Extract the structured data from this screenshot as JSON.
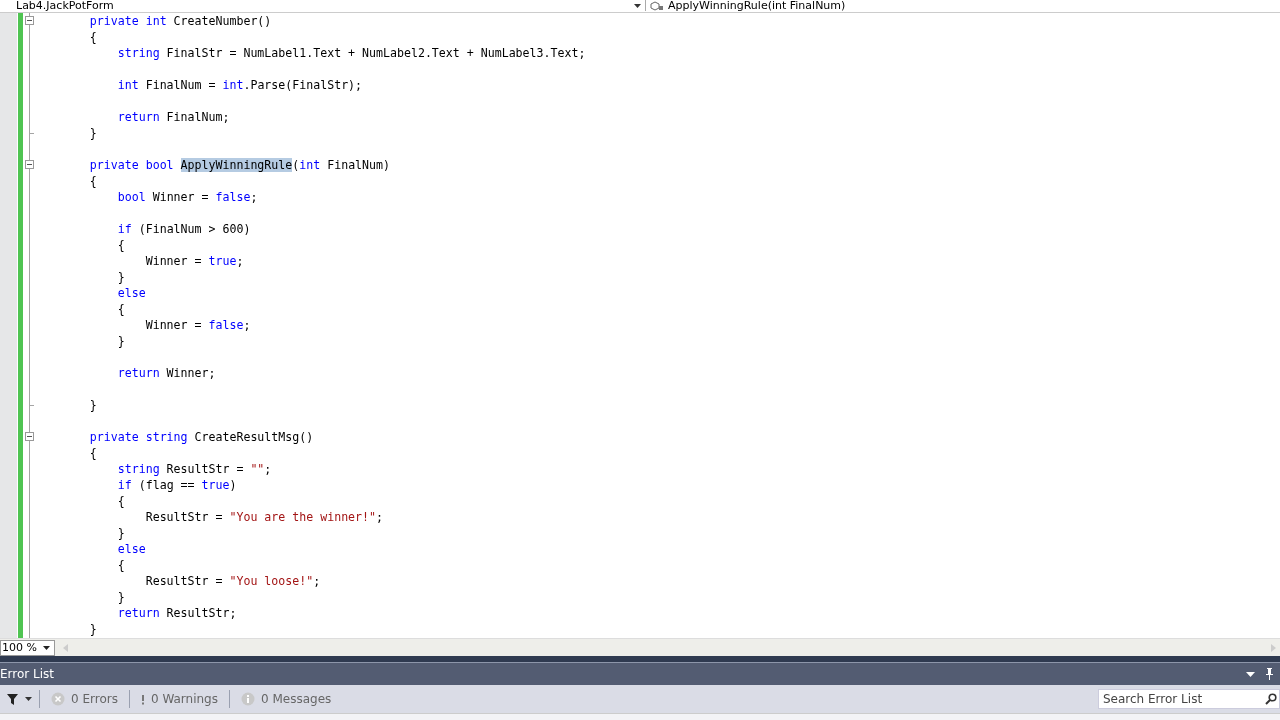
{
  "nav_bar": {
    "type_dropdown": "Lab4.JackPotForm",
    "member_dropdown": "ApplyWinningRule(int FinalNum)"
  },
  "code_lines": [
    {
      "kind": "header",
      "tokens": [
        {
          "kind": "kw",
          "t": "        private int"
        },
        {
          "kind": "plain",
          "t": " CreateNumber()"
        }
      ]
    },
    {
      "kind": "code",
      "tokens": [
        {
          "kind": "plain",
          "t": "        {"
        }
      ]
    },
    {
      "kind": "code",
      "tokens": [
        {
          "kind": "kw",
          "t": "            string"
        },
        {
          "kind": "plain",
          "t": " FinalStr = NumLabel1.Text + NumLabel2.Text + NumLabel3.Text;"
        }
      ]
    },
    {
      "kind": "code"
    },
    {
      "kind": "code",
      "tokens": [
        {
          "kind": "kw",
          "t": "            int"
        },
        {
          "kind": "plain",
          "t": " FinalNum = "
        },
        {
          "kind": "kw",
          "t": "int"
        },
        {
          "kind": "plain",
          "t": ".Parse(FinalStr);"
        }
      ]
    },
    {
      "kind": "code"
    },
    {
      "kind": "code",
      "tokens": [
        {
          "kind": "kw",
          "t": "            return"
        },
        {
          "kind": "plain",
          "t": " FinalNum;"
        }
      ]
    },
    {
      "kind": "end",
      "tokens": [
        {
          "kind": "plain",
          "t": "        }"
        }
      ]
    },
    {
      "kind": "code"
    },
    {
      "kind": "header",
      "tokens": [
        {
          "kind": "kw",
          "t": "        private bool "
        },
        {
          "kind": "sel",
          "t": "ApplyWinningRule"
        },
        {
          "kind": "plain",
          "t": "("
        },
        {
          "kind": "kw",
          "t": "int"
        },
        {
          "kind": "plain",
          "t": " FinalNum)"
        }
      ]
    },
    {
      "kind": "code",
      "tokens": [
        {
          "kind": "plain",
          "t": "        {"
        }
      ]
    },
    {
      "kind": "code",
      "tokens": [
        {
          "kind": "kw",
          "t": "            bool"
        },
        {
          "kind": "plain",
          "t": " Winner = "
        },
        {
          "kind": "kw",
          "t": "false"
        },
        {
          "kind": "plain",
          "t": ";"
        }
      ]
    },
    {
      "kind": "code"
    },
    {
      "kind": "code",
      "tokens": [
        {
          "kind": "kw",
          "t": "            if"
        },
        {
          "kind": "plain",
          "t": " (FinalNum > 600)"
        }
      ]
    },
    {
      "kind": "code",
      "tokens": [
        {
          "kind": "plain",
          "t": "            {"
        }
      ]
    },
    {
      "kind": "code",
      "tokens": [
        {
          "kind": "plain",
          "t": "                Winner = "
        },
        {
          "kind": "kw",
          "t": "true"
        },
        {
          "kind": "plain",
          "t": ";"
        }
      ]
    },
    {
      "kind": "code",
      "tokens": [
        {
          "kind": "plain",
          "t": "            }"
        }
      ]
    },
    {
      "kind": "code",
      "tokens": [
        {
          "kind": "kw",
          "t": "            else"
        }
      ]
    },
    {
      "kind": "code",
      "tokens": [
        {
          "kind": "plain",
          "t": "            {"
        }
      ]
    },
    {
      "kind": "code",
      "tokens": [
        {
          "kind": "plain",
          "t": "                Winner = "
        },
        {
          "kind": "kw",
          "t": "false"
        },
        {
          "kind": "plain",
          "t": ";"
        }
      ]
    },
    {
      "kind": "code",
      "tokens": [
        {
          "kind": "plain",
          "t": "            }"
        }
      ]
    },
    {
      "kind": "code"
    },
    {
      "kind": "code",
      "tokens": [
        {
          "kind": "kw",
          "t": "            return"
        },
        {
          "kind": "plain",
          "t": " Winner;"
        }
      ]
    },
    {
      "kind": "code"
    },
    {
      "kind": "end",
      "tokens": [
        {
          "kind": "plain",
          "t": "        }"
        }
      ]
    },
    {
      "kind": "code"
    },
    {
      "kind": "header",
      "tokens": [
        {
          "kind": "kw",
          "t": "        private string"
        },
        {
          "kind": "plain",
          "t": " CreateResultMsg()"
        }
      ]
    },
    {
      "kind": "code",
      "tokens": [
        {
          "kind": "plain",
          "t": "        {"
        }
      ]
    },
    {
      "kind": "code",
      "tokens": [
        {
          "kind": "kw",
          "t": "            string"
        },
        {
          "kind": "plain",
          "t": " ResultStr = "
        },
        {
          "kind": "str",
          "t": "\"\""
        },
        {
          "kind": "plain",
          "t": ";"
        }
      ]
    },
    {
      "kind": "code",
      "tokens": [
        {
          "kind": "kw",
          "t": "            if"
        },
        {
          "kind": "plain",
          "t": " (flag == "
        },
        {
          "kind": "kw",
          "t": "true"
        },
        {
          "kind": "plain",
          "t": ")"
        }
      ]
    },
    {
      "kind": "code",
      "tokens": [
        {
          "kind": "plain",
          "t": "            {"
        }
      ]
    },
    {
      "kind": "code",
      "tokens": [
        {
          "kind": "plain",
          "t": "                ResultStr = "
        },
        {
          "kind": "str",
          "t": "\"You are the winner!\""
        },
        {
          "kind": "plain",
          "t": ";"
        }
      ]
    },
    {
      "kind": "code",
      "tokens": [
        {
          "kind": "plain",
          "t": "            }"
        }
      ]
    },
    {
      "kind": "code",
      "tokens": [
        {
          "kind": "kw",
          "t": "            else"
        }
      ]
    },
    {
      "kind": "code",
      "tokens": [
        {
          "kind": "plain",
          "t": "            {"
        }
      ]
    },
    {
      "kind": "code",
      "tokens": [
        {
          "kind": "plain",
          "t": "                ResultStr = "
        },
        {
          "kind": "str",
          "t": "\"You loose!\""
        },
        {
          "kind": "plain",
          "t": ";"
        }
      ]
    },
    {
      "kind": "code",
      "tokens": [
        {
          "kind": "plain",
          "t": "            }"
        }
      ]
    },
    {
      "kind": "code",
      "tokens": [
        {
          "kind": "kw",
          "t": "            return"
        },
        {
          "kind": "plain",
          "t": " ResultStr;"
        }
      ]
    },
    {
      "kind": "code",
      "tokens": [
        {
          "kind": "plain",
          "t": "        }"
        }
      ]
    }
  ],
  "zoom": "100 %",
  "error_list": {
    "title": "Error List",
    "filters": [
      {
        "kind": "errors",
        "label": "0 Errors"
      },
      {
        "kind": "warnings",
        "label": "0 Warnings"
      },
      {
        "kind": "messages",
        "label": "0 Messages"
      }
    ],
    "search": {
      "placeholder": "Search Error List"
    }
  }
}
